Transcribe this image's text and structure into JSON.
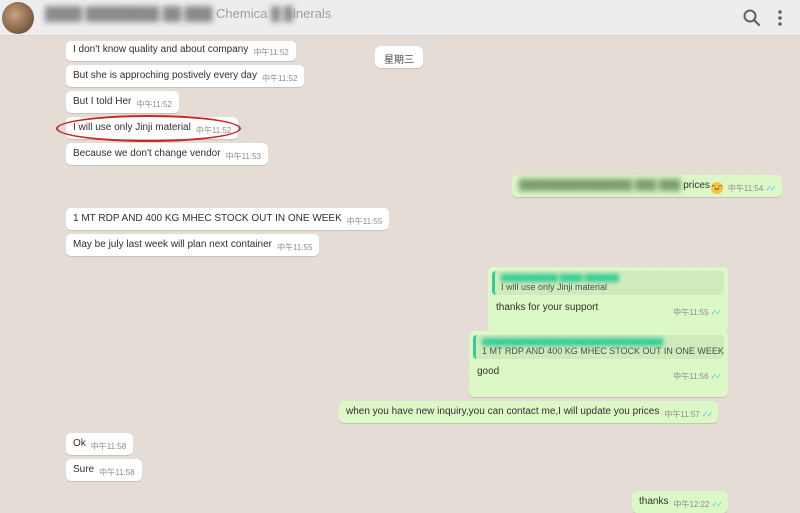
{
  "header": {
    "title_visible": "Chemica",
    "title_visible_2": "inerals",
    "icons": {
      "search": "search-icon",
      "menu": "more-vertical-icon"
    }
  },
  "date_chip": "星期三",
  "messages": {
    "m1": {
      "text": "I don't know quality and about company",
      "time": "中午11:52"
    },
    "m2": {
      "text": "But she is approching postively every day",
      "time": "中午11:52"
    },
    "m3": {
      "text": "But I told Her",
      "time": "中午11:52"
    },
    "m4": {
      "text": "I will use only Jinji material",
      "time": "中午11:52"
    },
    "m5": {
      "text": "Because we don't change vendor",
      "time": "中午11:53"
    },
    "m6": {
      "text": "prices",
      "time": "中午11:54",
      "ticks": "✓✓"
    },
    "m7": {
      "text": "1 MT RDP AND 400 KG MHEC STOCK OUT IN ONE WEEK",
      "time": "中午11:55"
    },
    "m8": {
      "text": "May be july last week will plan next container",
      "time": "中午11:55"
    },
    "m9": {
      "quote": "I will use only Jinji material",
      "text": "thanks for your support",
      "time": "中午11:55",
      "ticks": "✓✓"
    },
    "m10": {
      "quote": "1 MT RDP AND 400 KG MHEC STOCK OUT IN ONE WEEK",
      "text": "good",
      "time": "中午11:56",
      "ticks": "✓✓"
    },
    "m11": {
      "text": "when you have new inquiry,you can contact me,I will update you prices",
      "time": "中午11:57",
      "ticks": "✓✓"
    },
    "m12": {
      "text": "Ok",
      "time": "中午11:58"
    },
    "m13": {
      "text": "Sure",
      "time": "中午11:58"
    },
    "m14": {
      "text": "thanks",
      "time": "中午12:22",
      "ticks": "✓✓"
    }
  },
  "colors": {
    "incoming": "#ffffff",
    "outgoing": "#dcf8c6",
    "ticks": "#4fc3f7",
    "quote_bar": "#35cd96",
    "highlight": "#c62828"
  }
}
